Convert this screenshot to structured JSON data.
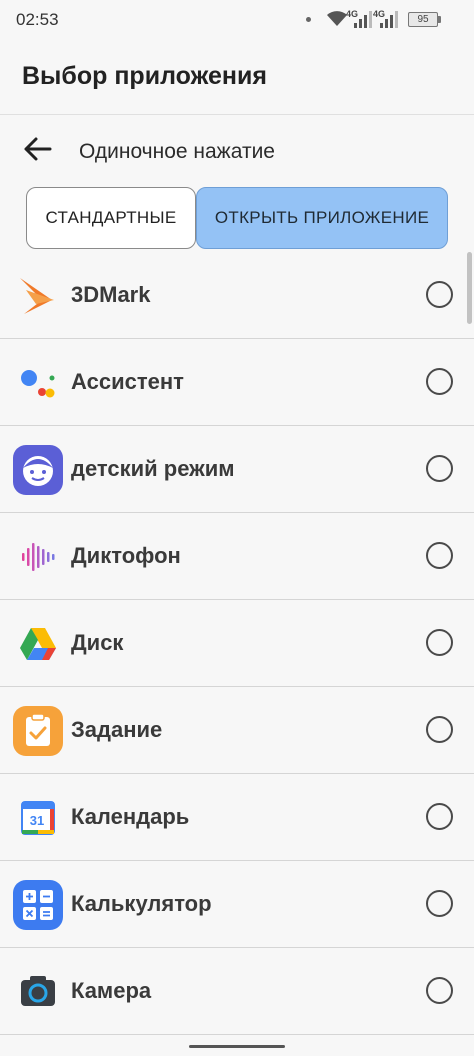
{
  "status": {
    "time": "02:53",
    "net1": "4G",
    "net2": "4G",
    "battery": "95"
  },
  "header": {
    "title": "Выбор приложения"
  },
  "subheader": {
    "title": "Одиночное нажатие",
    "back_icon": "arrow-left-icon"
  },
  "tabs": {
    "standard": "СТАНДАРТНЫЕ",
    "open_app": "ОТКРЫТЬ ПРИЛОЖЕНИЕ",
    "active_color": "#94c2f5"
  },
  "apps": [
    {
      "name": "3DMark",
      "icon": "3dmark-icon",
      "selected": false
    },
    {
      "name": "Ассистент",
      "icon": "assistant-icon",
      "selected": false
    },
    {
      "name": "детский режим",
      "icon": "kids-mode-icon",
      "selected": false
    },
    {
      "name": "Диктофон",
      "icon": "recorder-icon",
      "selected": false
    },
    {
      "name": "Диск",
      "icon": "drive-icon",
      "selected": false
    },
    {
      "name": "Задание",
      "icon": "tasks-icon",
      "selected": false
    },
    {
      "name": "Календарь",
      "icon": "calendar-icon",
      "selected": false
    },
    {
      "name": "Калькулятор",
      "icon": "calculator-icon",
      "selected": false
    },
    {
      "name": "Камера",
      "icon": "camera-icon",
      "selected": false
    }
  ],
  "calendar_icon_text": "31"
}
